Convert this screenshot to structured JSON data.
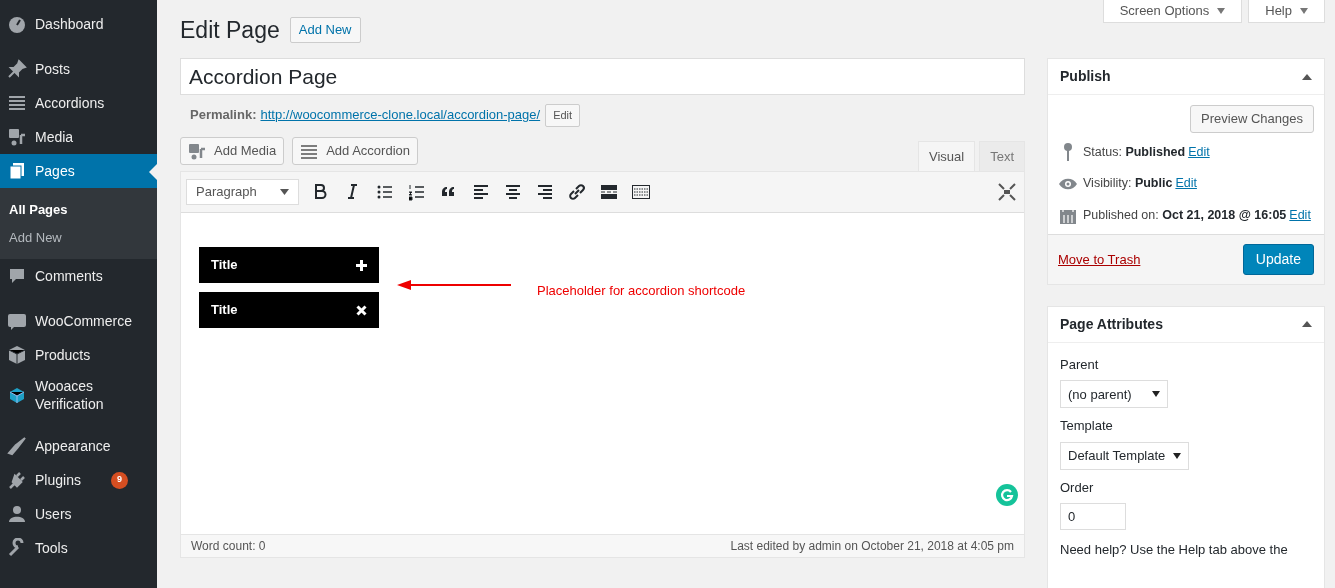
{
  "sidebar": {
    "groups": [
      [
        {
          "label": "Dashboard",
          "selected": false
        }
      ],
      [
        {
          "label": "Posts",
          "selected": false
        },
        {
          "label": "Accordions",
          "selected": false
        },
        {
          "label": "Media",
          "selected": false
        },
        {
          "label": "Pages",
          "selected": true,
          "children": [
            {
              "label": "All Pages",
              "selected": true
            },
            {
              "label": "Add New",
              "selected": false
            }
          ]
        },
        {
          "label": "Comments",
          "selected": false
        }
      ],
      [
        {
          "label": "WooCommerce",
          "selected": false
        },
        {
          "label": "Products",
          "selected": false
        },
        {
          "label": "Wooaces Verification",
          "selected": false
        }
      ],
      [
        {
          "label": "Appearance",
          "selected": false
        },
        {
          "label": "Plugins",
          "selected": false,
          "badge": "9"
        },
        {
          "label": "Users",
          "selected": false
        },
        {
          "label": "Tools",
          "selected": false
        }
      ]
    ]
  },
  "top_tabs": [
    "Screen Options",
    "Help"
  ],
  "heading": "Edit Page",
  "add_new": "Add New",
  "title_field": "Accordion Page",
  "permalink": {
    "label": "Permalink:",
    "url": "http://woocommerce-clone.local/accordion-page/",
    "edit": "Edit"
  },
  "media_buttons": [
    "Add Media",
    "Add Accordion"
  ],
  "editor_tabs": [
    {
      "label": "Visual",
      "selected": true
    },
    {
      "label": "Text",
      "selected": false
    }
  ],
  "format_select": "Paragraph",
  "content": {
    "accordion": [
      {
        "title": "Title",
        "expanded": false
      },
      {
        "title": "Title",
        "expanded": true
      }
    ],
    "annotation": "Placeholder for accordion shortcode"
  },
  "status_bar": {
    "word_count": "Word count: 0",
    "last_edited": "Last edited by admin on October 21, 2018 at 4:05 pm"
  },
  "publish": {
    "title": "Publish",
    "preview": "Preview Changes",
    "rows": [
      {
        "label": "Status:",
        "value": "Published",
        "link": "Edit"
      },
      {
        "label": "Visibility:",
        "value": "Public",
        "link": "Edit"
      },
      {
        "label": "Published on:",
        "value": "Oct 21, 2018 @ 16:05",
        "link": "Edit"
      }
    ],
    "trash": "Move to Trash",
    "update": "Update"
  },
  "page_attributes": {
    "title": "Page Attributes",
    "parent_label": "Parent",
    "parent": "(no parent)",
    "template_label": "Template",
    "template": "Default Template",
    "order_label": "Order",
    "order": "0",
    "help": "Need help? Use the Help tab above the"
  }
}
